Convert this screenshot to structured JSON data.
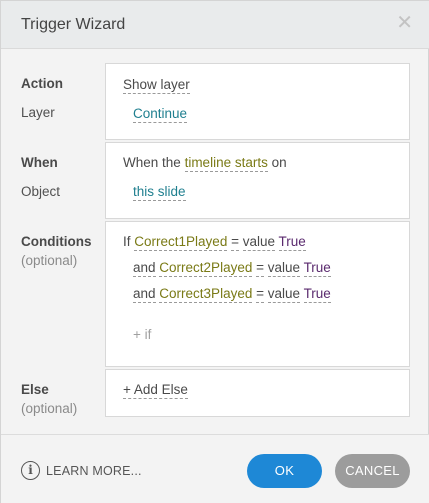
{
  "dialog": {
    "title": "Trigger Wizard",
    "close_glyph": "✕"
  },
  "action": {
    "label": "Action",
    "layer_label": "Layer",
    "value": "Show layer",
    "layer_value": "Continue"
  },
  "when": {
    "label": "When",
    "object_label": "Object",
    "prefix": "When the",
    "event": "timeline starts",
    "suffix": "on",
    "object_value": "this slide"
  },
  "conditions": {
    "label": "Conditions",
    "optional": "(optional)",
    "rows": [
      {
        "join": "If",
        "variable": "Correct1Played",
        "op": "=",
        "kind": "value",
        "value": "True"
      },
      {
        "join": "and",
        "variable": "Correct2Played",
        "op": "=",
        "kind": "value",
        "value": "True"
      },
      {
        "join": "and",
        "variable": "Correct3Played",
        "op": "=",
        "kind": "value",
        "value": "True"
      }
    ],
    "add_if": "+ if"
  },
  "else": {
    "label": "Else",
    "optional": "(optional)",
    "add_else": "+ Add Else"
  },
  "footer": {
    "learn_more": "LEARN MORE...",
    "ok": "OK",
    "cancel": "CANCEL",
    "info_icon": "info-icon"
  }
}
